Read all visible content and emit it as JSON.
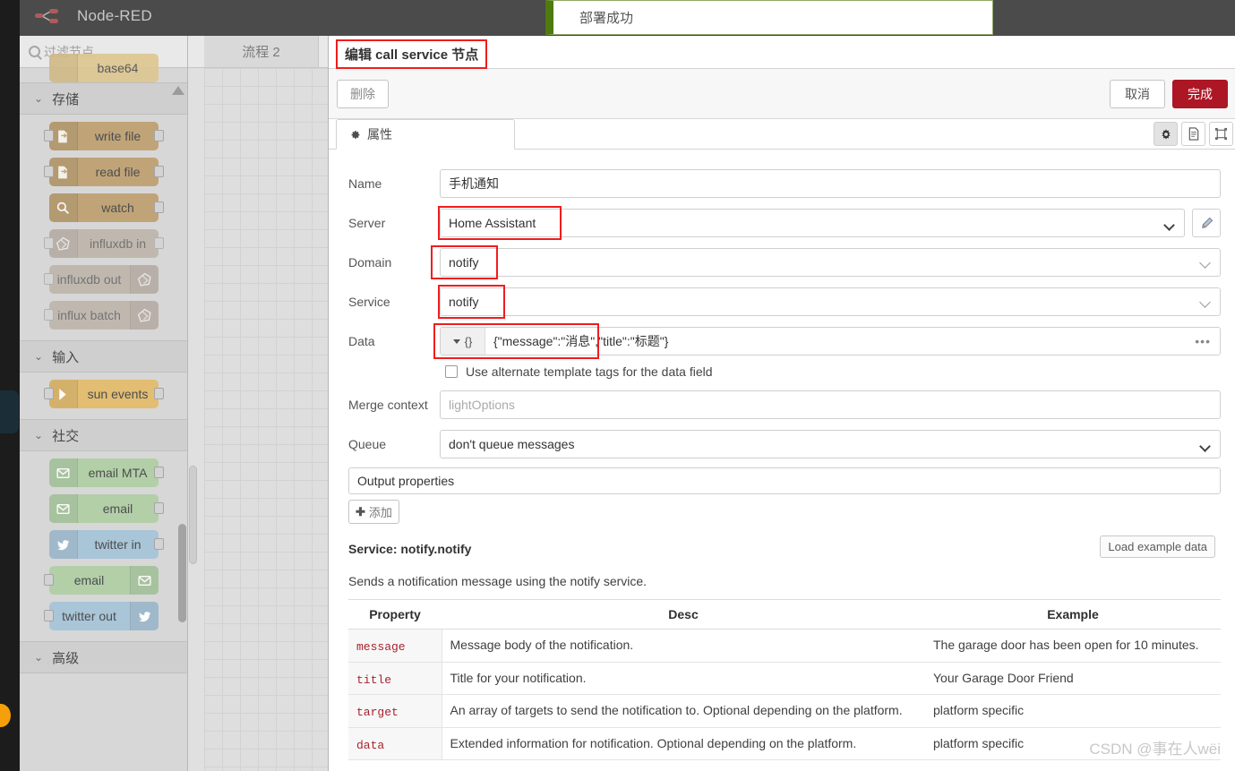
{
  "header": {
    "title": "Node-RED",
    "logo_icon": "node-red-logo-icon"
  },
  "notification": {
    "text": "部署成功",
    "accent": "#4e7a0e"
  },
  "palette": {
    "search_placeholder": "过滤节点",
    "search_icon": "search-icon",
    "categories": [
      {
        "title": "存储",
        "nodes": [
          {
            "label": "write file",
            "icon": "file-write-icon",
            "color": "#c0a478",
            "icon_side": "left",
            "ports": "both"
          },
          {
            "label": "read file",
            "icon": "file-read-icon",
            "color": "#c0a478",
            "icon_side": "left",
            "ports": "both"
          },
          {
            "label": "watch",
            "icon": "magnifier-icon",
            "color": "#c0a478",
            "icon_side": "left",
            "ports": "out"
          },
          {
            "label": "influxdb in",
            "icon": "influxdb-icon",
            "color": "#b8ada0",
            "icon_side": "left",
            "ports": "both"
          },
          {
            "label": "influxdb out",
            "icon": "influxdb-icon",
            "color": "#b8ada0",
            "icon_side": "right",
            "ports": "in"
          },
          {
            "label": "influx batch",
            "icon": "influxdb-icon",
            "color": "#b8ada0",
            "icon_side": "right",
            "ports": "in"
          }
        ]
      },
      {
        "title": "输入",
        "nodes": [
          {
            "label": "sun events",
            "icon": "arrow-right-icon",
            "color": "#e2bd72",
            "icon_side": "left",
            "ports": "both"
          }
        ]
      },
      {
        "title": "社交",
        "nodes": [
          {
            "label": "email MTA",
            "icon": "envelope-icon",
            "color": "#b2cfa8",
            "icon_side": "left",
            "ports": "out"
          },
          {
            "label": "email",
            "icon": "envelope-icon",
            "color": "#b2cfa8",
            "icon_side": "left",
            "ports": "out"
          },
          {
            "label": "twitter in",
            "icon": "twitter-icon",
            "color": "#a9c5d8",
            "icon_side": "left",
            "ports": "out"
          },
          {
            "label": "email",
            "icon": "envelope-icon",
            "color": "#b2cfa8",
            "icon_side": "right",
            "ports": "in"
          },
          {
            "label": "twitter out",
            "icon": "twitter-icon",
            "color": "#a9c5d8",
            "icon_side": "right",
            "ports": "in"
          }
        ]
      },
      {
        "title": "高级",
        "nodes": []
      }
    ]
  },
  "canvas": {
    "tab_label": "流程 2"
  },
  "dialog": {
    "title": "编辑 call service 节点",
    "buttons": {
      "delete": "删除",
      "cancel": "取消",
      "done": "完成"
    },
    "tab": {
      "label": "属性",
      "icon": "gear-icon"
    },
    "header_icons": [
      {
        "name": "gear-icon",
        "glyph": "✿"
      },
      {
        "name": "document-icon",
        "glyph": "🗎"
      },
      {
        "name": "expand-icon",
        "glyph": "⛶"
      }
    ],
    "fields": {
      "name_label": "Name",
      "name_value": "手机通知",
      "server_label": "Server",
      "server_value": "Home Assistant",
      "server_edit_icon": "pencil-icon",
      "domain_label": "Domain",
      "domain_value": "notify",
      "service_label": "Service",
      "service_value": "notify",
      "data_label": "Data",
      "data_type": "{}",
      "data_value": "{\"message\":\"消息\",\"title\":\"标题\"}",
      "data_menu_icon": "ellipsis-icon",
      "alt_template_label": "Use alternate template tags for the data field",
      "alt_template_checked": false,
      "merge_label": "Merge context",
      "merge_placeholder": "lightOptions",
      "queue_label": "Queue",
      "queue_value": "don't queue messages",
      "output_props_label": "Output properties",
      "add_button": "添加"
    },
    "service_info": {
      "title": "Service: notify.notify",
      "load_example_button": "Load example data",
      "description": "Sends a notification message using the notify service.",
      "table_headers": [
        "Property",
        "Desc",
        "Example"
      ],
      "table_rows": [
        {
          "property": "message",
          "desc": "Message body of the notification.",
          "example": "The garage door has been open for 10 minutes."
        },
        {
          "property": "title",
          "desc": "Title for your notification.",
          "example": "Your Garage Door Friend"
        },
        {
          "property": "target",
          "desc": "An array of targets to send the notification to. Optional depending on the platform.",
          "example": "platform specific"
        },
        {
          "property": "data",
          "desc": "Extended information for notification. Optional depending on the platform.",
          "example": "platform specific"
        }
      ]
    }
  },
  "watermark": "CSDN @事在人wëi",
  "colors": {
    "accent_red": "#ad1625",
    "highlight": "#f01d1d",
    "deploy_green": "#4e7a0e"
  }
}
